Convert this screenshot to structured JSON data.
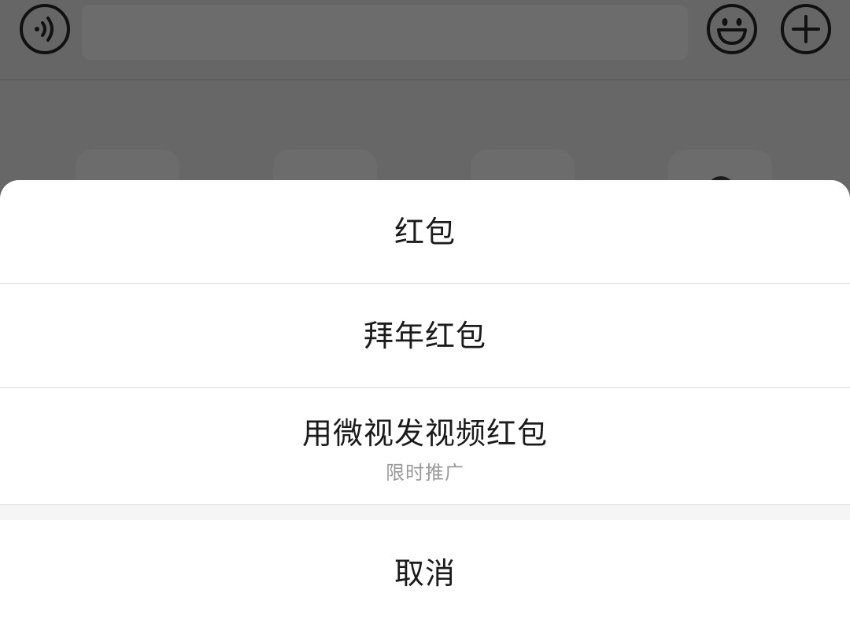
{
  "input_bar": {
    "icons": [
      "voice-icon",
      "emoji-icon",
      "plus-icon"
    ]
  },
  "action_sheet": {
    "options": [
      {
        "label": "红包"
      },
      {
        "label": "拜年红包"
      },
      {
        "label": "用微视发视频红包",
        "sublabel": "限时推广"
      }
    ],
    "cancel_label": "取消"
  },
  "colors": {
    "overlay": "#676767",
    "sheet_background": "#ffffff",
    "divider": "#e3e3e3",
    "gap": "#f5f5f5",
    "primary_text": "#1b1b1b",
    "secondary_text": "#9a9a9a",
    "icon_stroke": "#111111"
  }
}
